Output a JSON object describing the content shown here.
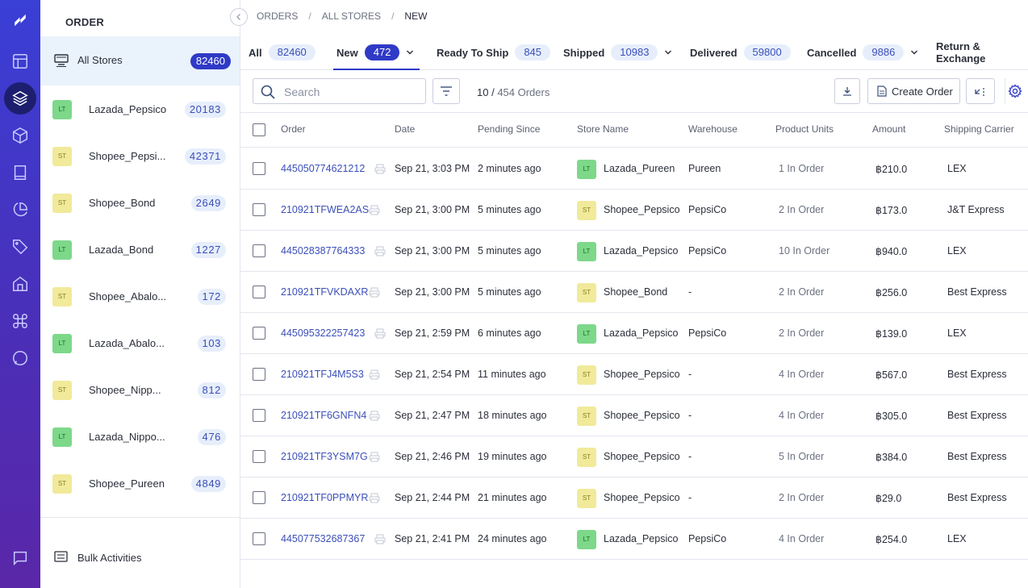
{
  "sidebar": {
    "title": "ORDER",
    "all_stores": {
      "label": "All Stores",
      "count": "82460"
    },
    "stores": [
      {
        "tag": "LT",
        "name": "Lazada_Pepsico",
        "count": "20183"
      },
      {
        "tag": "ST",
        "name": "Shopee_Pepsi...",
        "count": "42371"
      },
      {
        "tag": "ST",
        "name": "Shopee_Bond",
        "count": "2649"
      },
      {
        "tag": "LT",
        "name": "Lazada_Bond",
        "count": "1227"
      },
      {
        "tag": "ST",
        "name": "Shopee_Abalo...",
        "count": "172"
      },
      {
        "tag": "LT",
        "name": "Lazada_Abalo...",
        "count": "103"
      },
      {
        "tag": "ST",
        "name": "Shopee_Nipp...",
        "count": "812"
      },
      {
        "tag": "LT",
        "name": "Lazada_Nippo...",
        "count": "476"
      },
      {
        "tag": "ST",
        "name": "Shopee_Pureen",
        "count": "4849"
      }
    ],
    "bulk_activities": "Bulk Activities"
  },
  "rail": {
    "icons": [
      "logo-icon",
      "layout-icon",
      "layers-icon",
      "box-icon",
      "book-icon",
      "pie-chart-icon",
      "tag-icon",
      "home-icon",
      "command-icon",
      "chat-icon",
      "message-icon"
    ]
  },
  "breadcrumb": {
    "items": [
      "ORDERS",
      "ALL STORES",
      "NEW"
    ]
  },
  "tabs": [
    {
      "label": "All",
      "count": "82460"
    },
    {
      "label": "New",
      "count": "472"
    },
    {
      "label": "Ready To Ship",
      "count": "845"
    },
    {
      "label": "Shipped",
      "count": "10983"
    },
    {
      "label": "Delivered",
      "count": "59800"
    },
    {
      "label": "Cancelled",
      "count": "9886"
    },
    {
      "label": "Return & Exchange",
      "count": ""
    }
  ],
  "toolbar": {
    "search_placeholder": "Search",
    "shown": "10 /",
    "total": "454 Orders",
    "create_label": "Create Order"
  },
  "table": {
    "headers": [
      "Order",
      "Date",
      "Pending Since",
      "Store Name",
      "Warehouse",
      "Product Units",
      "Amount",
      "Shipping Carrier"
    ],
    "rows": [
      {
        "order": "445050774621212",
        "date": "Sep 21, 3:03 PM",
        "pending": "2 minutes ago",
        "tag": "LT",
        "store": "Lazada_Pureen",
        "warehouse": "Pureen",
        "units": "1 In Order",
        "amount": "฿210.0",
        "carrier": "LEX"
      },
      {
        "order": "210921TFWEA2AS",
        "date": "Sep 21, 3:00 PM",
        "pending": "5 minutes ago",
        "tag": "ST",
        "store": "Shopee_Pepsico",
        "warehouse": "PepsiCo",
        "units": "2 In Order",
        "amount": "฿173.0",
        "carrier": "J&T Express"
      },
      {
        "order": "445028387764333",
        "date": "Sep 21, 3:00 PM",
        "pending": "5 minutes ago",
        "tag": "LT",
        "store": "Lazada_Pepsico",
        "warehouse": "PepsiCo",
        "units": "10 In Order",
        "amount": "฿940.0",
        "carrier": "LEX"
      },
      {
        "order": "210921TFVKDAXR",
        "date": "Sep 21, 3:00 PM",
        "pending": "5 minutes ago",
        "tag": "ST",
        "store": "Shopee_Bond",
        "warehouse": "-",
        "units": "2 In Order",
        "amount": "฿256.0",
        "carrier": "Best Express"
      },
      {
        "order": "445095322257423",
        "date": "Sep 21, 2:59 PM",
        "pending": "6 minutes ago",
        "tag": "LT",
        "store": "Lazada_Pepsico",
        "warehouse": "PepsiCo",
        "units": "2 In Order",
        "amount": "฿139.0",
        "carrier": "LEX"
      },
      {
        "order": "210921TFJ4M5S3",
        "date": "Sep 21, 2:54 PM",
        "pending": "11 minutes ago",
        "tag": "ST",
        "store": "Shopee_Pepsico",
        "warehouse": "-",
        "units": "4 In Order",
        "amount": "฿567.0",
        "carrier": "Best Express"
      },
      {
        "order": "210921TF6GNFN4",
        "date": "Sep 21, 2:47 PM",
        "pending": "18 minutes ago",
        "tag": "ST",
        "store": "Shopee_Pepsico",
        "warehouse": "-",
        "units": "4 In Order",
        "amount": "฿305.0",
        "carrier": "Best Express"
      },
      {
        "order": "210921TF3YSM7G",
        "date": "Sep 21, 2:46 PM",
        "pending": "19 minutes ago",
        "tag": "ST",
        "store": "Shopee_Pepsico",
        "warehouse": "-",
        "units": "5 In Order",
        "amount": "฿384.0",
        "carrier": "Best Express"
      },
      {
        "order": "210921TF0PPMYR",
        "date": "Sep 21, 2:44 PM",
        "pending": "21 minutes ago",
        "tag": "ST",
        "store": "Shopee_Pepsico",
        "warehouse": "-",
        "units": "2 In Order",
        "amount": "฿29.0",
        "carrier": "Best Express"
      },
      {
        "order": "445077532687367",
        "date": "Sep 21, 2:41 PM",
        "pending": "24 minutes ago",
        "tag": "LT",
        "store": "Lazada_Pepsico",
        "warehouse": "PepsiCo",
        "units": "4 In Order",
        "amount": "฿254.0",
        "carrier": "LEX"
      }
    ]
  },
  "colors": {
    "accent": "#2f3ac6",
    "link": "#3b4fb8",
    "rail_top": "#3a3fd6",
    "rail_bottom": "#5a27a8",
    "selected_bg": "#eaf3fc"
  }
}
